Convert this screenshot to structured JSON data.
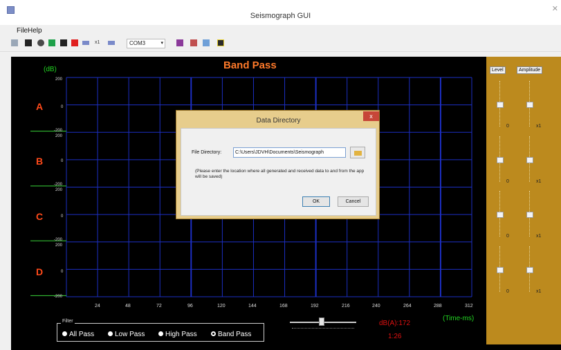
{
  "window": {
    "title": "Seismograph GUI"
  },
  "menu": {
    "file": "File",
    "help": "Help"
  },
  "toolbar": {
    "port": "COM3"
  },
  "plot": {
    "title": "Band Pass",
    "y_unit": "(dB)",
    "x_unit": "(Time-ms)",
    "channels": [
      "A",
      "B",
      "C",
      "D"
    ],
    "y_ticks": [
      {
        "top": "200",
        "mid": "0"
      },
      {
        "top": "200",
        "mid": "0",
        "bottom": "-200"
      },
      {
        "top": "200",
        "mid": "0",
        "bottom": "-200"
      },
      {
        "top": "200",
        "mid": "0",
        "bottom": "-200"
      }
    ],
    "x_ticks": [
      "24",
      "48",
      "72",
      "96",
      "120",
      "144",
      "168",
      "192",
      "216",
      "240",
      "264",
      "288",
      "312"
    ],
    "grid_color": "#1c2fc4",
    "trace_color": "#39d639"
  },
  "filters": {
    "legend": "Filter",
    "options": [
      "All Pass",
      "Low Pass",
      "High Pass",
      "Band Pass"
    ],
    "selected": "Band Pass"
  },
  "readout": {
    "dba": "dB(A):172",
    "time": "1:26"
  },
  "right_panel": {
    "level_label": "Level",
    "amplitude_label": "Amplitude",
    "level_values": [
      "0",
      "0",
      "0",
      "0"
    ],
    "amplitude_values": [
      "x1",
      "x1",
      "x1",
      "x1"
    ]
  },
  "dialog": {
    "title": "Data Directory",
    "close": "x",
    "field_label": "File Directory:",
    "field_value": "C:\\Users\\JDVH\\Documents\\Seismograph",
    "note": "(Please enter the location where all generated and received data to and from the app will be saved)",
    "ok": "OK",
    "cancel": "Cancel"
  },
  "colors": {
    "panel": "#bc8a1e",
    "dialog_frame": "#e7cd8c",
    "channel_label": "#ff4a1a",
    "title": "#ff7a2a"
  }
}
